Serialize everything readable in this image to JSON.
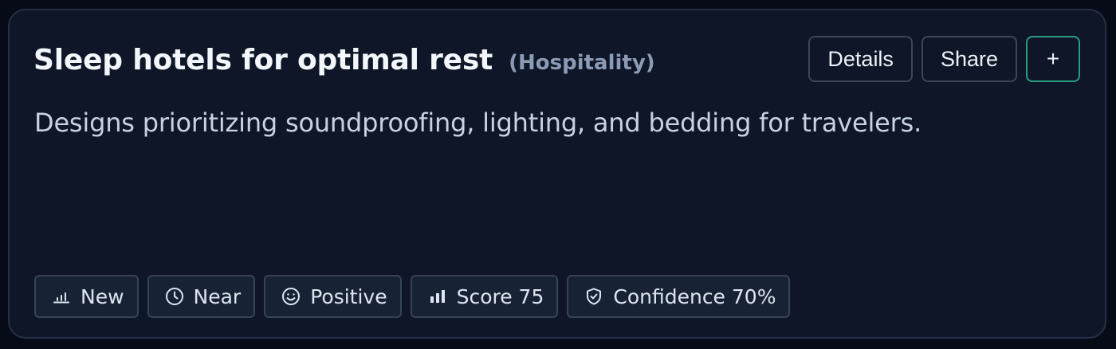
{
  "card": {
    "title": "Sleep hotels for optimal rest",
    "category": "(Hospitality)",
    "description": "Designs prioritizing soundproofing, lighting, and bedding for travelers."
  },
  "actions": {
    "details_label": "Details",
    "share_label": "Share",
    "add_label": "+"
  },
  "tags": [
    {
      "icon": "bar-chart-low-icon",
      "label": "New"
    },
    {
      "icon": "clock-icon",
      "label": "Near"
    },
    {
      "icon": "smile-icon",
      "label": "Positive"
    },
    {
      "icon": "bar-chart-icon",
      "label": "Score 75"
    },
    {
      "icon": "shield-check-icon",
      "label": "Confidence 70%"
    }
  ],
  "colors": {
    "background": "#070b17",
    "card": "#0e1627",
    "accent": "#2a9d7d"
  }
}
